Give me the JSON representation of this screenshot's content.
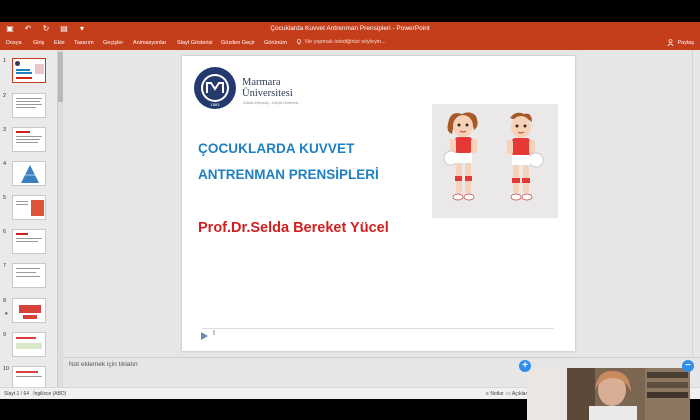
{
  "window": {
    "title": "Çocuklarda Kuvvet  Antrenman Prensipleri  -  PowerPoint"
  },
  "ribbon": {
    "tabs": [
      "Dosya",
      "Giriş",
      "Ekle",
      "Tasarım",
      "Geçişler",
      "Animasyonlar",
      "Slayt Gösterisi",
      "Gözden Geçir",
      "Görünüm"
    ],
    "tell_me_placeholder": "Ne yapmak istediğinizi söyleyin...",
    "share_label": "Paylaş"
  },
  "thumbnails": [
    {
      "num": "1",
      "selected": true
    },
    {
      "num": "2"
    },
    {
      "num": "3"
    },
    {
      "num": "4"
    },
    {
      "num": "5"
    },
    {
      "num": "6"
    },
    {
      "num": "7"
    },
    {
      "num": "8",
      "star": true
    },
    {
      "num": "9"
    },
    {
      "num": "10"
    }
  ],
  "slide": {
    "university_line1": "Marmara",
    "university_line2": "Üniversitesi",
    "university_tagline": "Sürdü Geçmiş...Güçlü Gelecek...",
    "seal_year": "1883",
    "title_line1": "ÇOCUKLARDA KUVVET",
    "title_line2": "ANTRENMAN PRENSİPLERİ",
    "author": "Prof.Dr.Selda Bereket Yücel",
    "footer_mark": "I"
  },
  "notes": {
    "placeholder": "Not eklemek için tıklatın"
  },
  "status": {
    "slide_info": "Slayt 1 / 64",
    "language": "İngilizce (ABD)",
    "notes_label": "Notlar",
    "comments_label": "Açıklamalar"
  },
  "colors": {
    "ribbon": "#c43e1c",
    "title_blue": "#1f7fc0",
    "author_red": "#d21f1f",
    "accent_blue": "#2f8fe9"
  }
}
